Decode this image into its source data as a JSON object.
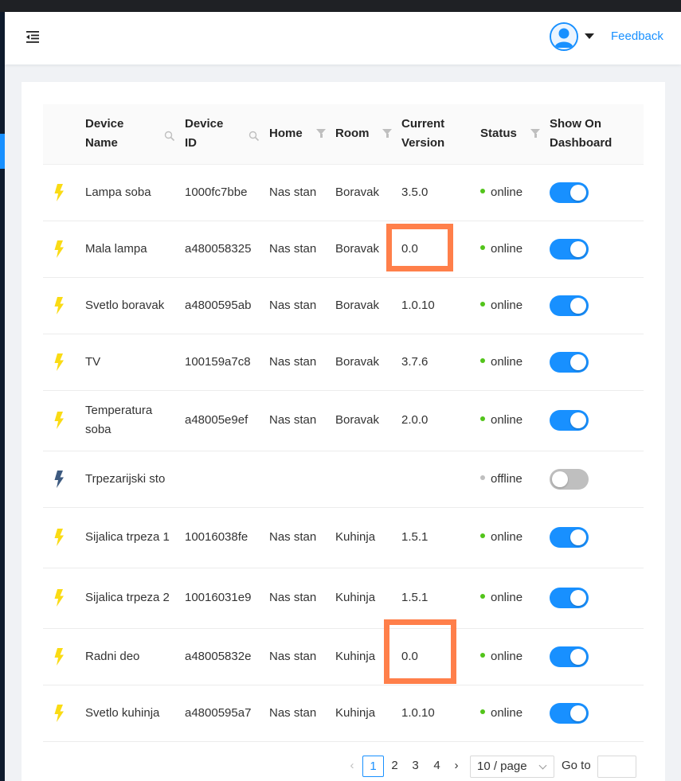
{
  "header": {
    "feedback_label": "Feedback",
    "menu_icon": "menu-fold-icon",
    "avatar_icon": "user-avatar-icon"
  },
  "table": {
    "columns": [
      {
        "label": "",
        "key": "icon"
      },
      {
        "label": "Device Name",
        "icon": "search-icon"
      },
      {
        "label": "Device ID",
        "icon": "search-icon"
      },
      {
        "label": "Home",
        "icon": "filter-icon"
      },
      {
        "label": "Room",
        "icon": "filter-icon"
      },
      {
        "label": "Current Version"
      },
      {
        "label": "Status",
        "icon": "filter-icon"
      },
      {
        "label": "Show On Dashboard"
      }
    ],
    "rows": [
      {
        "name": "Lampa soba",
        "device_id": "1000fc7bbe",
        "home": "Nas stan",
        "room": "Boravak",
        "version": "3.5.0",
        "status": "online",
        "dashboard": true
      },
      {
        "name": "Mala lampa",
        "device_id": "a480058325",
        "home": "Nas stan",
        "room": "Boravak",
        "version": "0.0",
        "status": "online",
        "dashboard": true
      },
      {
        "name": "Svetlo boravak",
        "device_id": "a4800595ab",
        "home": "Nas stan",
        "room": "Boravak",
        "version": "1.0.10",
        "status": "online",
        "dashboard": true
      },
      {
        "name": "TV",
        "device_id": "100159a7c8",
        "home": "Nas stan",
        "room": "Boravak",
        "version": "3.7.6",
        "status": "online",
        "dashboard": true
      },
      {
        "name": "Temperatura soba",
        "device_id": "a48005e9ef",
        "home": "Nas stan",
        "room": "Boravak",
        "version": "2.0.0",
        "status": "online",
        "dashboard": true
      },
      {
        "name": "Trpezarijski sto",
        "device_id": "",
        "home": "",
        "room": "",
        "version": "",
        "status": "offline",
        "dashboard": false
      },
      {
        "name": "Sijalica trpeza 1",
        "device_id": "10016038fe",
        "home": "Nas stan",
        "room": "Kuhinja",
        "version": "1.5.1",
        "status": "online",
        "dashboard": true
      },
      {
        "name": "Sijalica trpeza 2",
        "device_id": "10016031e9",
        "home": "Nas stan",
        "room": "Kuhinja",
        "version": "1.5.1",
        "status": "online",
        "dashboard": true
      },
      {
        "name": "Radni deo",
        "device_id": "a48005832e",
        "home": "Nas stan",
        "room": "Kuhinja",
        "version": "0.0",
        "status": "online",
        "dashboard": true
      },
      {
        "name": "Svetlo kuhinja",
        "device_id": "a4800595a7",
        "home": "Nas stan",
        "room": "Kuhinja",
        "version": "1.0.10",
        "status": "online",
        "dashboard": true
      }
    ]
  },
  "pagination": {
    "pages": [
      "1",
      "2",
      "3",
      "4"
    ],
    "current_page": "1",
    "page_size": "10 / page",
    "goto_label": "Go to"
  },
  "colors": {
    "accent": "#1890ff",
    "online": "#52c41a",
    "offline": "#bfbfbf",
    "bolt_online": "#fadb14",
    "bolt_offline": "#3d5a80",
    "highlight": "#ff7f4a"
  }
}
